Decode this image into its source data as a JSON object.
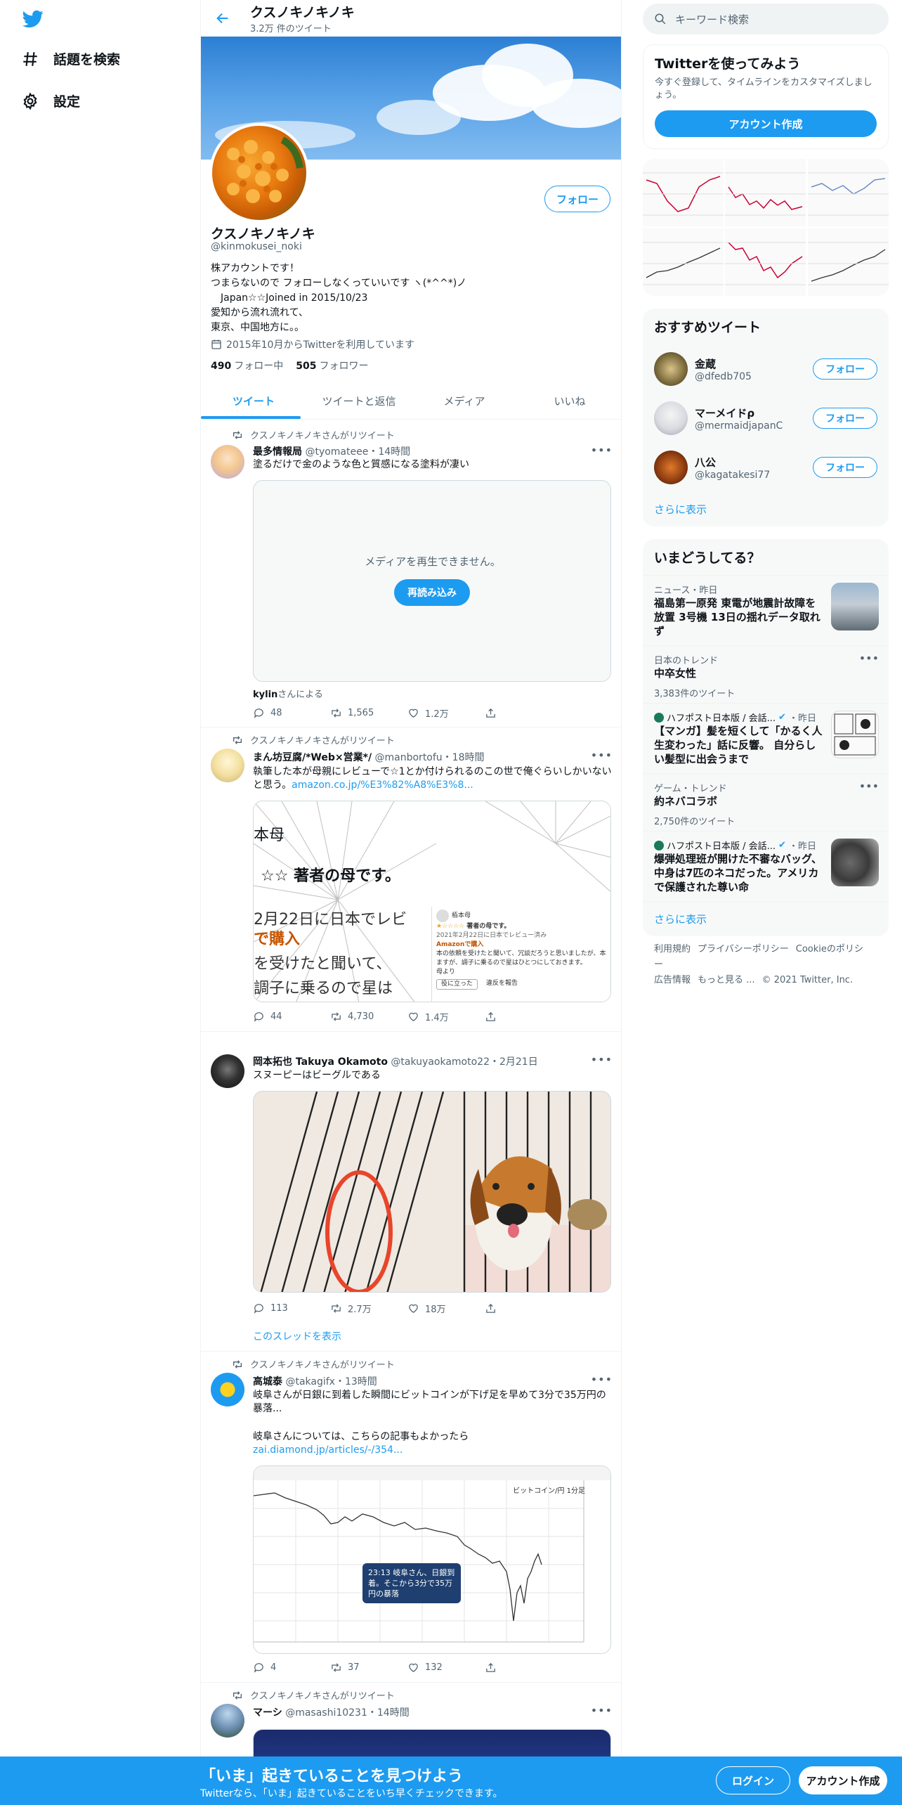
{
  "nav": {
    "explore": "話題を検索",
    "settings": "設定"
  },
  "profile": {
    "name": "クスノキノキノキ",
    "tweet_count": "3.2万 件のツイート",
    "handle": "@kinmokusei_noki",
    "bio": "株アカウントです！\nつまらないので フォローしなくっていいです ヽ(*^^*)ノ\n　Japan☆☆Joined in 2015/10/23\n愛知から流れ流れて、\n東京、中国地方に。。",
    "joined": "2015年10月からTwitterを利用しています",
    "following_count": "490",
    "following_label": "フォロー中",
    "followers_count": "505",
    "followers_label": "フォロワー",
    "follow_button": "フォロー"
  },
  "tabs": [
    "ツイート",
    "ツイートと返信",
    "メディア",
    "いいね"
  ],
  "tweets": [
    {
      "rt": "クスノキノキノキさんがリツイート",
      "name": "最多情報局",
      "handle": "@tyomateee",
      "time": "・14時間",
      "text": "塗るだけで金のような色と質感になる塗料が凄い",
      "media_error": "メディアを再生できません。",
      "reload": "再読み込み",
      "via_name": "kylin",
      "via_suffix": "さんによる",
      "replies": "48",
      "retweets": "1,565",
      "likes": "1.2万"
    },
    {
      "rt": "クスノキノキノキさんがリツイート",
      "name": "まん坊豆腐/*Web×営業*/",
      "handle": "@manbortofu",
      "time": "・18時間",
      "text": "執筆した本が母親にレビューで☆1とか付けられるのこの世で俺ぐらいしかいないと思う。",
      "link": "amazon.co.jp/%E3%82%A8%E3%8...",
      "img_t1": "本母",
      "img_t2": "☆☆ 著者の母です。",
      "img_t3": "2月22日に日本でレビ",
      "img_t4": "で購入",
      "img_t5": "を受けたと聞いて、",
      "img_t6": "調子に乗るので星は",
      "review_user": "栢本母",
      "review_title": "著者の母です。",
      "review_date": "2021年2月22日に日本でレビュー済み",
      "review_buy": "Amazonで購入",
      "review_body": "本の依頼を受けたと聞いて、冗談だろうと思いましたが、本ますが、調子に乗るので星はひとつにしておきます。",
      "review_sign": "母より",
      "review_helpful": "役に立った",
      "review_report": "違反を報告",
      "replies": "44",
      "retweets": "4,730",
      "likes": "1.4万"
    },
    {
      "name": "岡本拓也 Takuya Okamoto",
      "handle": "@takuyaokamoto22",
      "time": "・2月21日",
      "text": "スヌーピーはビーグルである",
      "replies": "113",
      "retweets": "2.7万",
      "likes": "18万",
      "thread": "このスレッドを表示"
    },
    {
      "rt": "クスノキノキノキさんがリツイート",
      "name": "高城泰",
      "handle": "@takagifx",
      "time": "・13時間",
      "text": "岐阜さんが日銀に到着した瞬間にビットコインが下げ足を早めて3分で35万円の暴落...",
      "text2": "岐阜さんについては、こちらの記事もよかったら",
      "link": "zai.diamond.jp/articles/-/354...",
      "chart_label": "ビットコイン/円 1分足",
      "bubble": "23:13 岐阜さん、日銀到着。そこから3分で35万円の暴落",
      "replies": "4",
      "retweets": "37",
      "likes": "132"
    },
    {
      "rt": "クスノキノキノキさんがリツイート",
      "name": "マーシ",
      "handle": "@masashi10231",
      "time": "・14時間"
    }
  ],
  "right": {
    "search_placeholder": "キーワード検索",
    "signup_title": "Twitterを使ってみよう",
    "signup_text": "今すぐ登録して、タイムラインをカスタマイズしましょう。",
    "signup_button": "アカウント作成",
    "rec_title": "おすすめツイート",
    "rec_users": [
      {
        "name": "金蔵",
        "handle": "@dfedb705"
      },
      {
        "name": "マーメイドρ",
        "handle": "@mermaidjapanC"
      },
      {
        "name": "八公",
        "handle": "@kagatakesi77"
      }
    ],
    "rec_follow": "フォロー",
    "show_more": "さらに表示",
    "trends_title": "いまどうしてる？",
    "trends": [
      {
        "meta": "ニュース・昨日",
        "title": "福島第一原発 東電が地震計故障を放置 3号機 13日の揺れデータ取れず"
      },
      {
        "meta": "日本のトレンド",
        "title": "中卒女性",
        "count": "3,383件のツイート"
      },
      {
        "meta": "ハフポスト日本版 / 会話...",
        "meta2": "・昨日",
        "title": "【マンガ】髪を短くして「かるく人生変わった」話に反響。 自分らしい髪型に出会うまで"
      },
      {
        "meta": "ゲーム・トレンド",
        "title": "約ネバコラボ",
        "count": "2,750件のツイート"
      },
      {
        "meta": "ハフポスト日本版 / 会話...",
        "meta2": "・昨日",
        "title": "爆弾処理班が開けた不審なバッグ、中身は7匹のネコだった。アメリカで保護された尊い命"
      }
    ],
    "footer": [
      "利用規約",
      "プライバシーポリシー",
      "Cookieのポリシー",
      "広告情報",
      "もっと見る ...",
      "© 2021 Twitter, Inc."
    ]
  },
  "bottom": {
    "title": "「いま」起きていることを見つけよう",
    "sub": "Twitterなら、「いま」起きていることをいち早くチェックできます。",
    "login": "ログイン",
    "signup": "アカウント作成"
  },
  "colors": {
    "accent": "#1d9bf0",
    "text": "#0f1419",
    "muted": "#536471"
  }
}
